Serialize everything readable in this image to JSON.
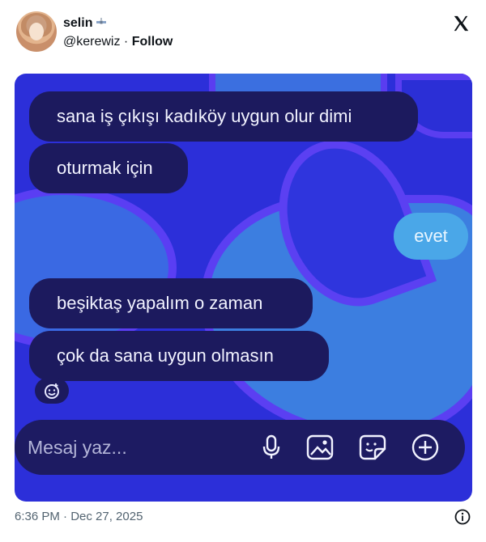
{
  "post": {
    "user_name": "selin",
    "user_badge_icon": "satellite-icon",
    "handle": "@kerewiz",
    "separator": " · ",
    "follow_label": "Follow",
    "timestamp": "6:36 PM · Dec 27, 2025"
  },
  "chat": {
    "messages": [
      {
        "side": "left",
        "text": "sana iş çıkışı kadıköy uygun olur dimi"
      },
      {
        "side": "left",
        "text": "oturmak için"
      },
      {
        "side": "right",
        "text": "evet"
      },
      {
        "side": "left",
        "text": "beşiktaş yapalım o zaman"
      },
      {
        "side": "left",
        "text": "çok da sana uygun olmasın"
      }
    ],
    "input_placeholder": "Mesaj yaz..."
  },
  "colors": {
    "chat_background": "#2c2fd9",
    "incoming_bubble": "#1c1a5e",
    "outgoing_bubble": "#4aa7e8"
  }
}
